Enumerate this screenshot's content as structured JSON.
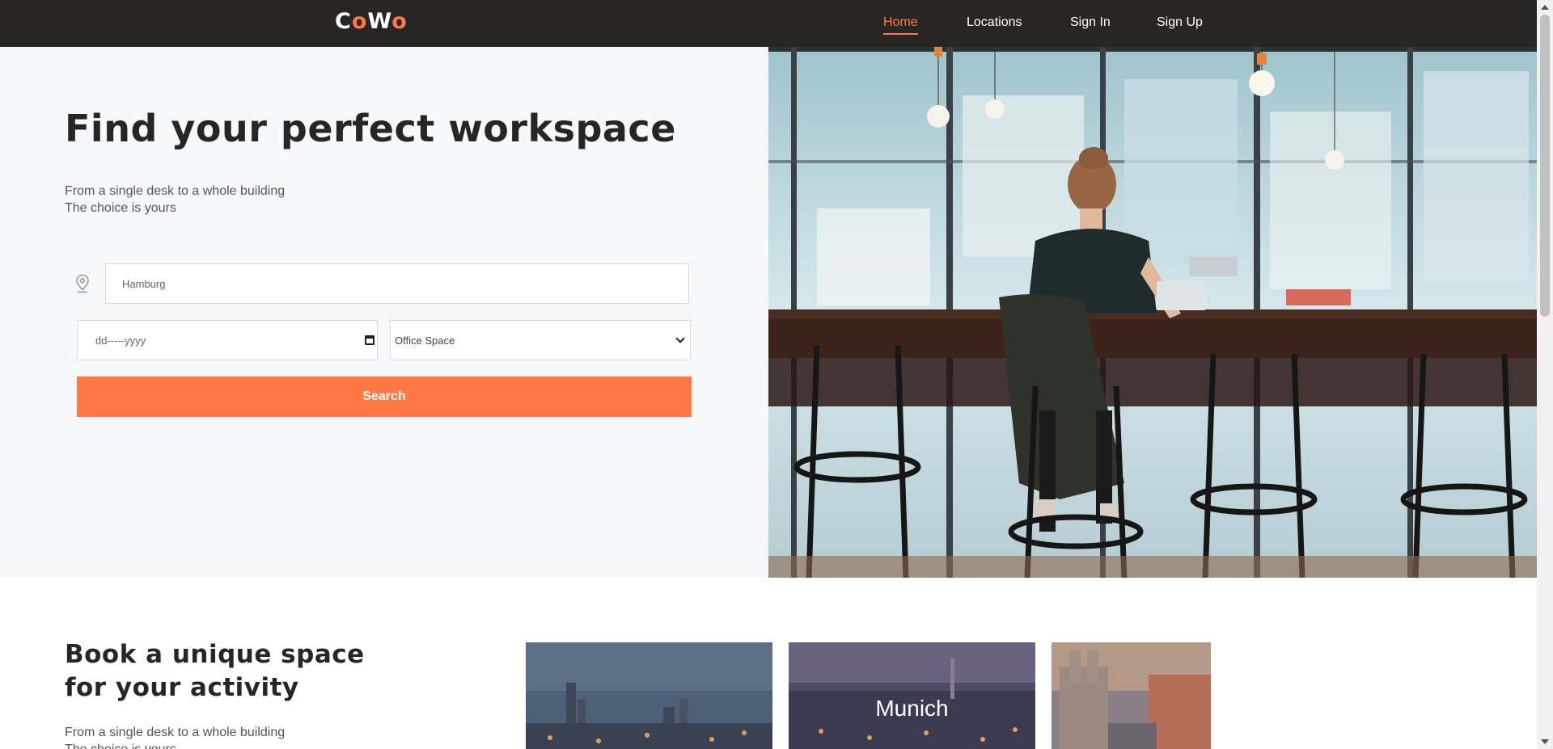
{
  "nav": {
    "logo": {
      "part1": "C",
      "part2": "o",
      "part3": "W",
      "part4": "o"
    },
    "links": [
      {
        "label": "Home",
        "active": true
      },
      {
        "label": "Locations",
        "active": false
      },
      {
        "label": "Sign In",
        "active": false
      },
      {
        "label": "Sign Up",
        "active": false
      }
    ]
  },
  "hero": {
    "title": "Find your perfect workspace",
    "subtitle_line1": "From a single desk to a whole building",
    "subtitle_line2": "The choice is yours",
    "location": {
      "value": "Hamburg"
    },
    "date": {
      "placeholder": "dd-----yyyy"
    },
    "space_type": {
      "selected": "Office Space"
    },
    "search_label": "Search"
  },
  "section": {
    "title_line1": "Book a unique space",
    "title_line2": "for your activity",
    "subtitle_line1": "From a single desk to a whole building",
    "subtitle_line2": "The choice is yours"
  },
  "cards": [
    {
      "label": ""
    },
    {
      "label": "Munich"
    },
    {
      "label": ""
    }
  ],
  "colors": {
    "accent": "#ff7846",
    "nav_bg": "#282624",
    "hero_bg": "#f7f8fa"
  },
  "icons": {
    "location": "map-pin-icon",
    "calendar": "calendar-icon",
    "dropdown": "chevron-down-icon"
  }
}
